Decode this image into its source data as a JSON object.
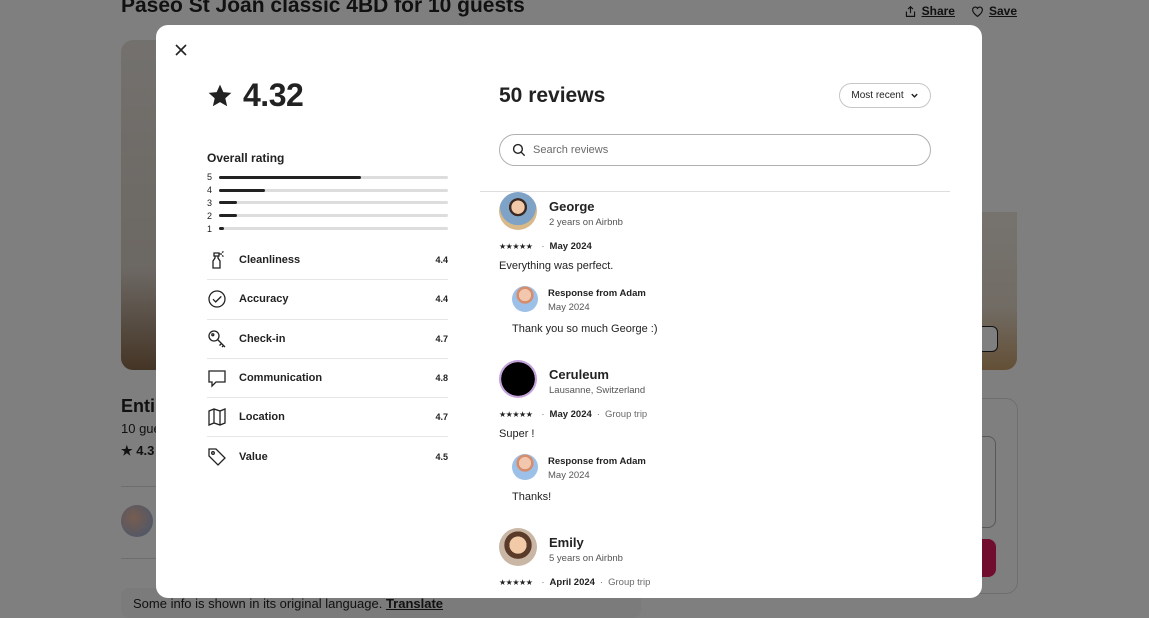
{
  "background": {
    "title": "Paseo St Joan classic 4BD for 10 guests",
    "share_label": "Share",
    "save_label": "Save",
    "entire_text": "Enti",
    "guests_text": "10 gue",
    "rating_text": "4.3",
    "translate_text": "Some info is shown in its original language.",
    "translate_link": "Translate"
  },
  "modal": {
    "rating": "4.32",
    "overall_title": "Overall rating",
    "distribution": [
      {
        "label": "5",
        "fraction": 0.62
      },
      {
        "label": "4",
        "fraction": 0.2
      },
      {
        "label": "3",
        "fraction": 0.08
      },
      {
        "label": "2",
        "fraction": 0.08
      },
      {
        "label": "1",
        "fraction": 0.02
      }
    ],
    "categories": [
      {
        "name": "Cleanliness",
        "score": "4.4",
        "icon": "spray-bottle-icon"
      },
      {
        "name": "Accuracy",
        "score": "4.4",
        "icon": "check-circle-icon"
      },
      {
        "name": "Check-in",
        "score": "4.7",
        "icon": "key-icon"
      },
      {
        "name": "Communication",
        "score": "4.8",
        "icon": "speech-bubble-icon"
      },
      {
        "name": "Location",
        "score": "4.7",
        "icon": "map-icon"
      },
      {
        "name": "Value",
        "score": "4.5",
        "icon": "tag-icon"
      }
    ],
    "reviews_count": "50 reviews",
    "sort_label": "Most recent",
    "search_placeholder": "Search reviews",
    "reviews": [
      {
        "name": "George",
        "subtitle": "2 years on Airbnb",
        "stars": "★★★★★",
        "date": "May 2024",
        "trip": "",
        "text": "Everything was perfect.",
        "response": {
          "from": "Response from Adam",
          "date": "May 2024",
          "text": "Thank you so much George :)"
        }
      },
      {
        "name": "Ceruleum",
        "subtitle": "Lausanne, Switzerland",
        "stars": "★★★★★",
        "date": "May 2024",
        "trip": "Group trip",
        "text": "Super !",
        "response": {
          "from": "Response from Adam",
          "date": "May 2024",
          "text": "Thanks!"
        }
      },
      {
        "name": "Emily",
        "subtitle": "5 years on Airbnb",
        "stars": "★★★★★",
        "date": "April 2024",
        "trip": "Group trip",
        "text": "",
        "response": null
      }
    ]
  },
  "colors": {
    "accent": "#e31c5f",
    "text": "#222222",
    "muted": "#6a6a6a"
  }
}
